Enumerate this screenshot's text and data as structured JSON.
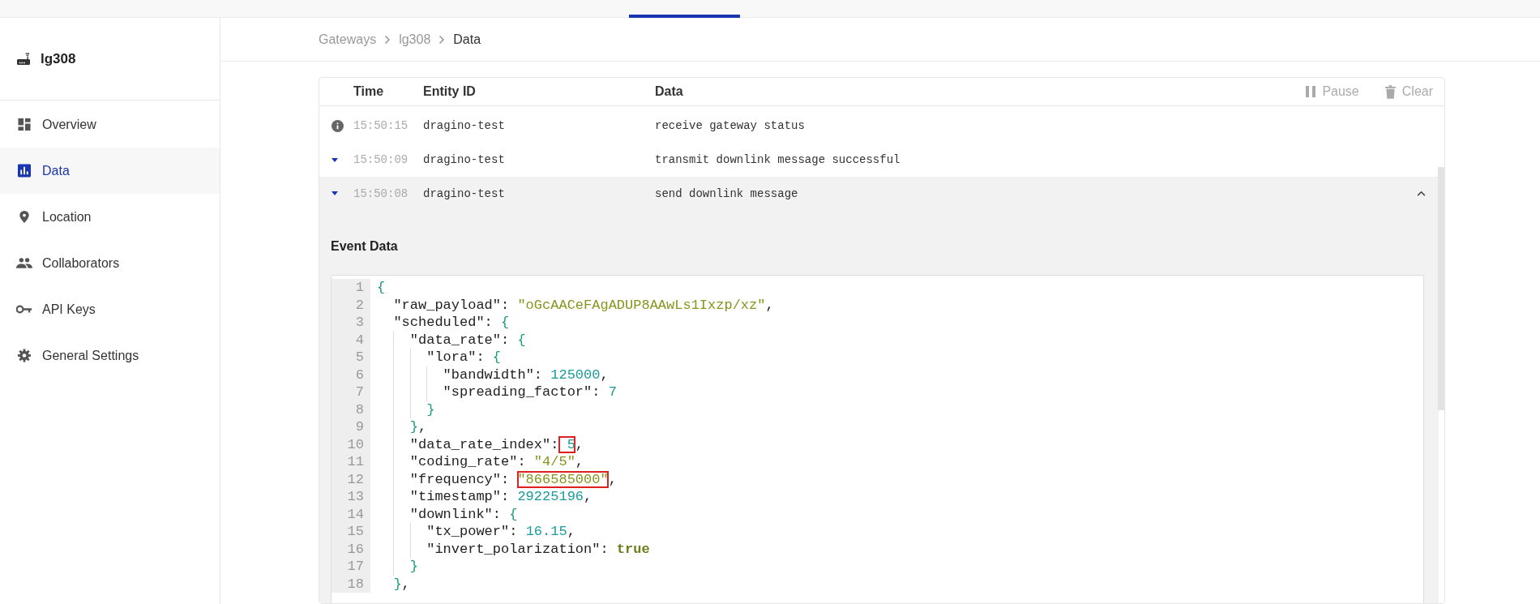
{
  "sidebar": {
    "gateway_name": "lg308",
    "items": [
      {
        "label": "Overview",
        "selected": false
      },
      {
        "label": "Data",
        "selected": true
      },
      {
        "label": "Location",
        "selected": false
      },
      {
        "label": "Collaborators",
        "selected": false
      },
      {
        "label": "API Keys",
        "selected": false
      },
      {
        "label": "General Settings",
        "selected": false
      }
    ]
  },
  "breadcrumb": [
    "Gateways",
    "lg308",
    "Data"
  ],
  "table": {
    "columns": [
      "Time",
      "Entity ID",
      "Data"
    ],
    "actions": [
      "Pause",
      "Clear"
    ],
    "rows": [
      {
        "time": "15:50:15",
        "entity": "dragino-test",
        "data": "receive gateway status",
        "expanded": false
      },
      {
        "time": "15:50:09",
        "entity": "dragino-test",
        "data": "transmit downlink message successful",
        "expanded": false
      },
      {
        "time": "15:50:08",
        "entity": "dragino-test",
        "data": "send downlink message",
        "expanded": true
      }
    ]
  },
  "event_data": {
    "title": "Event Data",
    "lines": [
      {
        "number": "1",
        "tokens": [
          {
            "t": "{",
            "kind": "brace",
            "boxed": false
          }
        ]
      },
      {
        "number": "2",
        "tokens": [
          {
            "t": "  \"raw_payload\"",
            "kind": "key",
            "boxed": false
          },
          {
            "t": ": ",
            "kind": "plain",
            "boxed": false
          },
          {
            "t": "\"oGcAACeFAgADUP8AAwLs1Ixzp/xz\"",
            "kind": "string",
            "boxed": false
          },
          {
            "t": ",",
            "kind": "plain",
            "boxed": false
          }
        ]
      },
      {
        "number": "3",
        "tokens": [
          {
            "t": "  \"scheduled\"",
            "kind": "key",
            "boxed": false
          },
          {
            "t": ": ",
            "kind": "plain",
            "boxed": false
          },
          {
            "t": "{",
            "kind": "brace",
            "boxed": false
          }
        ]
      },
      {
        "number": "4",
        "tokens": [
          {
            "t": "    \"data_rate\"",
            "kind": "key",
            "boxed": false
          },
          {
            "t": ": ",
            "kind": "plain",
            "boxed": false
          },
          {
            "t": "{",
            "kind": "brace",
            "boxed": false
          }
        ]
      },
      {
        "number": "5",
        "tokens": [
          {
            "t": "      \"lora\"",
            "kind": "key",
            "boxed": false
          },
          {
            "t": ": ",
            "kind": "plain",
            "boxed": false
          },
          {
            "t": "{",
            "kind": "brace",
            "boxed": false
          }
        ]
      },
      {
        "number": "6",
        "tokens": [
          {
            "t": "        \"bandwidth\"",
            "kind": "key",
            "boxed": false
          },
          {
            "t": ": ",
            "kind": "plain",
            "boxed": false
          },
          {
            "t": "125000",
            "kind": "number",
            "boxed": false
          },
          {
            "t": ",",
            "kind": "plain",
            "boxed": false
          }
        ]
      },
      {
        "number": "7",
        "tokens": [
          {
            "t": "        \"spreading_factor\"",
            "kind": "key",
            "boxed": false
          },
          {
            "t": ": ",
            "kind": "plain",
            "boxed": false
          },
          {
            "t": "7",
            "kind": "number",
            "boxed": false
          }
        ]
      },
      {
        "number": "8",
        "tokens": [
          {
            "t": "      }",
            "kind": "brace",
            "boxed": false
          }
        ]
      },
      {
        "number": "9",
        "tokens": [
          {
            "t": "    }",
            "kind": "brace",
            "boxed": false
          },
          {
            "t": ",",
            "kind": "plain",
            "boxed": false
          }
        ]
      },
      {
        "number": "10",
        "tokens": [
          {
            "t": "    \"data_rate_index\"",
            "kind": "key",
            "boxed": false
          },
          {
            "t": ":",
            "kind": "plain",
            "boxed": false
          },
          {
            "t": " 5",
            "kind": "number",
            "boxed": true
          },
          {
            "t": ",",
            "kind": "plain",
            "boxed": false
          }
        ]
      },
      {
        "number": "11",
        "tokens": [
          {
            "t": "    \"coding_rate\"",
            "kind": "key",
            "boxed": false
          },
          {
            "t": ": ",
            "kind": "plain",
            "boxed": false
          },
          {
            "t": "\"4/5\"",
            "kind": "string",
            "boxed": false
          },
          {
            "t": ",",
            "kind": "plain",
            "boxed": false
          }
        ]
      },
      {
        "number": "12",
        "tokens": [
          {
            "t": "    \"frequency\"",
            "kind": "key",
            "boxed": false
          },
          {
            "t": ": ",
            "kind": "plain",
            "boxed": false
          },
          {
            "t": "\"866585000\"",
            "kind": "string",
            "boxed": true
          },
          {
            "t": ",",
            "kind": "plain",
            "boxed": false
          }
        ]
      },
      {
        "number": "13",
        "tokens": [
          {
            "t": "    \"timestamp\"",
            "kind": "key",
            "boxed": false
          },
          {
            "t": ": ",
            "kind": "plain",
            "boxed": false
          },
          {
            "t": "29225196",
            "kind": "number",
            "boxed": false
          },
          {
            "t": ",",
            "kind": "plain",
            "boxed": false
          }
        ]
      },
      {
        "number": "14",
        "tokens": [
          {
            "t": "    \"downlink\"",
            "kind": "key",
            "boxed": false
          },
          {
            "t": ": ",
            "kind": "plain",
            "boxed": false
          },
          {
            "t": "{",
            "kind": "brace",
            "boxed": false
          }
        ]
      },
      {
        "number": "15",
        "tokens": [
          {
            "t": "      \"tx_power\"",
            "kind": "key",
            "boxed": false
          },
          {
            "t": ": ",
            "kind": "plain",
            "boxed": false
          },
          {
            "t": "16.15",
            "kind": "number",
            "boxed": false
          },
          {
            "t": ",",
            "kind": "plain",
            "boxed": false
          }
        ]
      },
      {
        "number": "16",
        "tokens": [
          {
            "t": "      \"invert_polarization\"",
            "kind": "key",
            "boxed": false
          },
          {
            "t": ": ",
            "kind": "plain",
            "boxed": false
          },
          {
            "t": "true",
            "kind": "boolean",
            "boxed": false
          }
        ]
      },
      {
        "number": "17",
        "tokens": [
          {
            "t": "    }",
            "kind": "brace",
            "boxed": false
          }
        ]
      },
      {
        "number": "18",
        "tokens": [
          {
            "t": "  }",
            "kind": "brace",
            "boxed": false
          },
          {
            "t": ",",
            "kind": "plain",
            "boxed": false
          }
        ]
      }
    ]
  }
}
